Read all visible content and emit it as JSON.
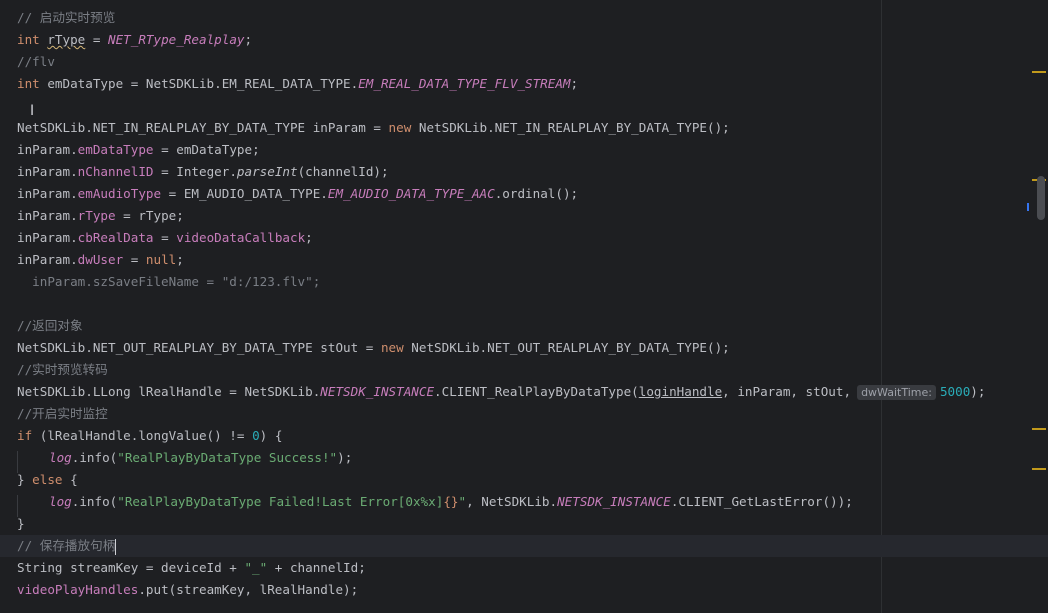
{
  "lines": {
    "l1": "// 启动实时预览",
    "l2_kw": "int",
    "l2_var": "rType",
    "l2_eq": " = ",
    "l2_const": "NET_RType_Realplay",
    "l2_end": ";",
    "l3": "//flv",
    "l4_kw": "int",
    "l4_a": " emDataType = NetSDKLib.EM_REAL_DATA_TYPE.",
    "l4_const": "EM_REAL_DATA_TYPE_FLV_STREAM",
    "l4_end": ";",
    "l6_a": "NetSDKLib.NET_IN_REALPLAY_BY_DATA_TYPE inParam = ",
    "l6_kw": "new",
    "l6_b": " NetSDKLib.NET_IN_REALPLAY_BY_DATA_TYPE();",
    "l7_a": "inParam.",
    "l7_f": "emDataType",
    "l7_b": " = emDataType;",
    "l8_a": "inParam.",
    "l8_f": "nChannelID",
    "l8_b": " = Integer.",
    "l8_m": "parseInt",
    "l8_c": "(channelId);",
    "l9_a": "inParam.",
    "l9_f": "emAudioType",
    "l9_b": " = EM_AUDIO_DATA_TYPE.",
    "l9_const": "EM_AUDIO_DATA_TYPE_AAC",
    "l9_c": ".ordinal();",
    "l10_a": "inParam.",
    "l10_f": "rType",
    "l10_b": " = rType;",
    "l11_a": "inParam.",
    "l11_f": "cbRealData",
    "l11_b": " = ",
    "l11_v": "videoDataCallback",
    "l11_c": ";",
    "l12_a": "inParam.",
    "l12_f": "dwUser",
    "l12_b": " = ",
    "l12_kw": "null",
    "l12_c": ";",
    "l13": "  inParam.szSaveFileName = \"d:/123.flv\";",
    "l15": "//返回对象",
    "l16_a": "NetSDKLib.NET_OUT_REALPLAY_BY_DATA_TYPE stOut = ",
    "l16_kw": "new",
    "l16_b": " NetSDKLib.NET_OUT_REALPLAY_BY_DATA_TYPE();",
    "l17": "//实时预览转码",
    "l18_a": "NetSDKLib.LLong lRealHandle = NetSDKLib.",
    "l18_const": "NETSDK_INSTANCE",
    "l18_b": ".CLIENT_RealPlayByDataType(",
    "l18_u": "loginHandle",
    "l18_c": ", inParam, stOut,",
    "l18_hint": "dwWaitTime:",
    "l18_num": "5000",
    "l18_d": ");",
    "l19": "//开启实时监控",
    "l20_kw": "if",
    "l20_a": " (lRealHandle.longValue() != ",
    "l20_num": "0",
    "l20_b": ") {",
    "l21_log": "log",
    "l21_a": ".info(",
    "l21_str": "\"RealPlayByDataType Success!\"",
    "l21_b": ");",
    "l22_a": "} ",
    "l22_kw": "else",
    "l22_b": " {",
    "l23_log": "log",
    "l23_a": ".info(",
    "l23_str1": "\"RealPlayByDataType Failed!Last Error[",
    "l23_fmt": "0x%x",
    "l23_str2": "]",
    "l23_br": "{}",
    "l23_str3": "\"",
    "l23_b": ", NetSDKLib.",
    "l23_const": "NETSDK_INSTANCE",
    "l23_c": ".CLIENT_GetLastError());",
    "l24": "}",
    "l25": "// 保存播放句柄",
    "l26_a": "String streamKey = deviceId + ",
    "l26_str": "\"_\"",
    "l26_b": " + channelId;",
    "l27_v": "videoPlayHandles",
    "l27_a": ".put(streamKey, lRealHandle);"
  },
  "colors": {
    "background": "#1e1f22",
    "keyword": "#cf8e6d",
    "constant": "#c77dbb",
    "string": "#6aab73",
    "number": "#2aacb8",
    "comment": "#7a7e85",
    "text": "#bcbec4"
  }
}
